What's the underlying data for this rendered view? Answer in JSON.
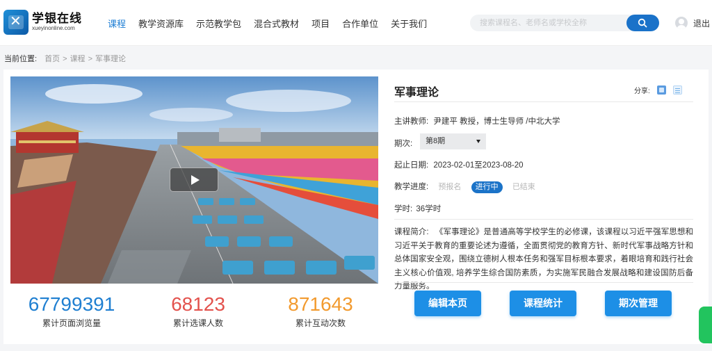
{
  "brand": {
    "name": "学银在线",
    "domain": "xueyinonline.com"
  },
  "nav": {
    "items": [
      {
        "label": "课程",
        "active": true
      },
      {
        "label": "教学资源库"
      },
      {
        "label": "示范教学包"
      },
      {
        "label": "混合式教材"
      },
      {
        "label": "项目"
      },
      {
        "label": "合作单位"
      },
      {
        "label": "关于我们"
      }
    ]
  },
  "search": {
    "placeholder": "搜索课程名、老师名或学校全称",
    "button_icon": "search-icon"
  },
  "user": {
    "avatar_icon": "user-icon",
    "logout_label": "退出"
  },
  "breadcrumb": {
    "label": "当前位置:",
    "items": [
      "首页",
      "课程",
      "军事理论"
    ],
    "separator": ">"
  },
  "course": {
    "title": "军事理论",
    "share_label": "分享:",
    "teacher_label": "主讲教师:",
    "teacher": "尹建平 教授，博士生导师 /中北大学",
    "term_label": "期次:",
    "term_value": "第8期",
    "dates_label": "起止日期:",
    "dates": "2023-02-01至2023-08-20",
    "progress_label": "教学进度:",
    "progress_states": [
      "预报名",
      "进行中",
      "已结束"
    ],
    "hours_label": "学时:",
    "hours": "36学时",
    "intro_label": "课程简介:",
    "intro": "《军事理论》是普通高等学校学生的必修课，该课程以习近平强军思想和习近平关于教育的重要论述为遵循，全面贯彻党的教育方针、新时代军事战略方针和总体国家安全观，围绕立德树人根本任务和强军目标根本要求，着眼培育和践行社会主义核心价值观, 培养学生综合国防素质，为实施军民融合发展战略和建设国防后备力量服务。"
  },
  "stats": [
    {
      "value": "67799391",
      "label": "累计页面浏览量",
      "color": "#1f7fd1"
    },
    {
      "value": "68123",
      "label": "累计选课人数",
      "color": "#e3524d"
    },
    {
      "value": "871643",
      "label": "累计互动次数",
      "color": "#f29a2e"
    }
  ],
  "actions": [
    "编辑本页",
    "课程统计",
    "期次管理"
  ],
  "colors": {
    "accent": "#1c7dd4",
    "button": "#1d8fe6",
    "active_stage": "#1b73c8",
    "side_tab": "#22c45e"
  }
}
